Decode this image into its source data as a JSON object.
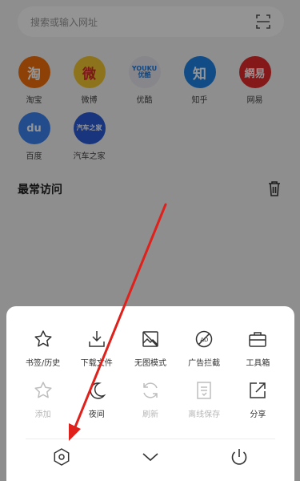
{
  "search": {
    "placeholder": "搜索或输入网址"
  },
  "sites": [
    [
      {
        "label": "淘宝",
        "logo": "淘",
        "color": "#f3700c"
      },
      {
        "label": "微博",
        "logo": "微",
        "color": "#f3c630"
      },
      {
        "label": "优酷",
        "logo": "YOUKU 优酷",
        "color": "#e8e8ef"
      },
      {
        "label": "知乎",
        "logo": "知",
        "color": "#1e84e8"
      },
      {
        "label": "网易",
        "logo": "網易",
        "color": "#e52a2a"
      }
    ],
    [
      {
        "label": "百度",
        "logo": "du",
        "color": "#3c84f2"
      },
      {
        "label": "汽车之家",
        "logo": "汽车之家",
        "color": "#2a5cd8"
      }
    ]
  ],
  "frequent": {
    "title": "最常访问"
  },
  "menu": {
    "row1": [
      {
        "label": "书签/历史",
        "icon": "star-icon"
      },
      {
        "label": "下载文件",
        "icon": "download-icon"
      },
      {
        "label": "无图模式",
        "icon": "no-image-icon"
      },
      {
        "label": "广告拦截",
        "icon": "ad-block-icon"
      },
      {
        "label": "工具箱",
        "icon": "toolbox-icon"
      }
    ],
    "row2": [
      {
        "label": "添加",
        "icon": "add-star-icon",
        "disabled": true
      },
      {
        "label": "夜间",
        "icon": "moon-icon",
        "disabled": false
      },
      {
        "label": "刷新",
        "icon": "refresh-icon",
        "disabled": true
      },
      {
        "label": "离线保存",
        "icon": "offline-save-icon",
        "disabled": true
      },
      {
        "label": "分享",
        "icon": "share-icon",
        "disabled": false
      }
    ]
  },
  "colors": {
    "annotation": "#e0201b",
    "overlay": "rgba(0,0,0,0.42)"
  }
}
